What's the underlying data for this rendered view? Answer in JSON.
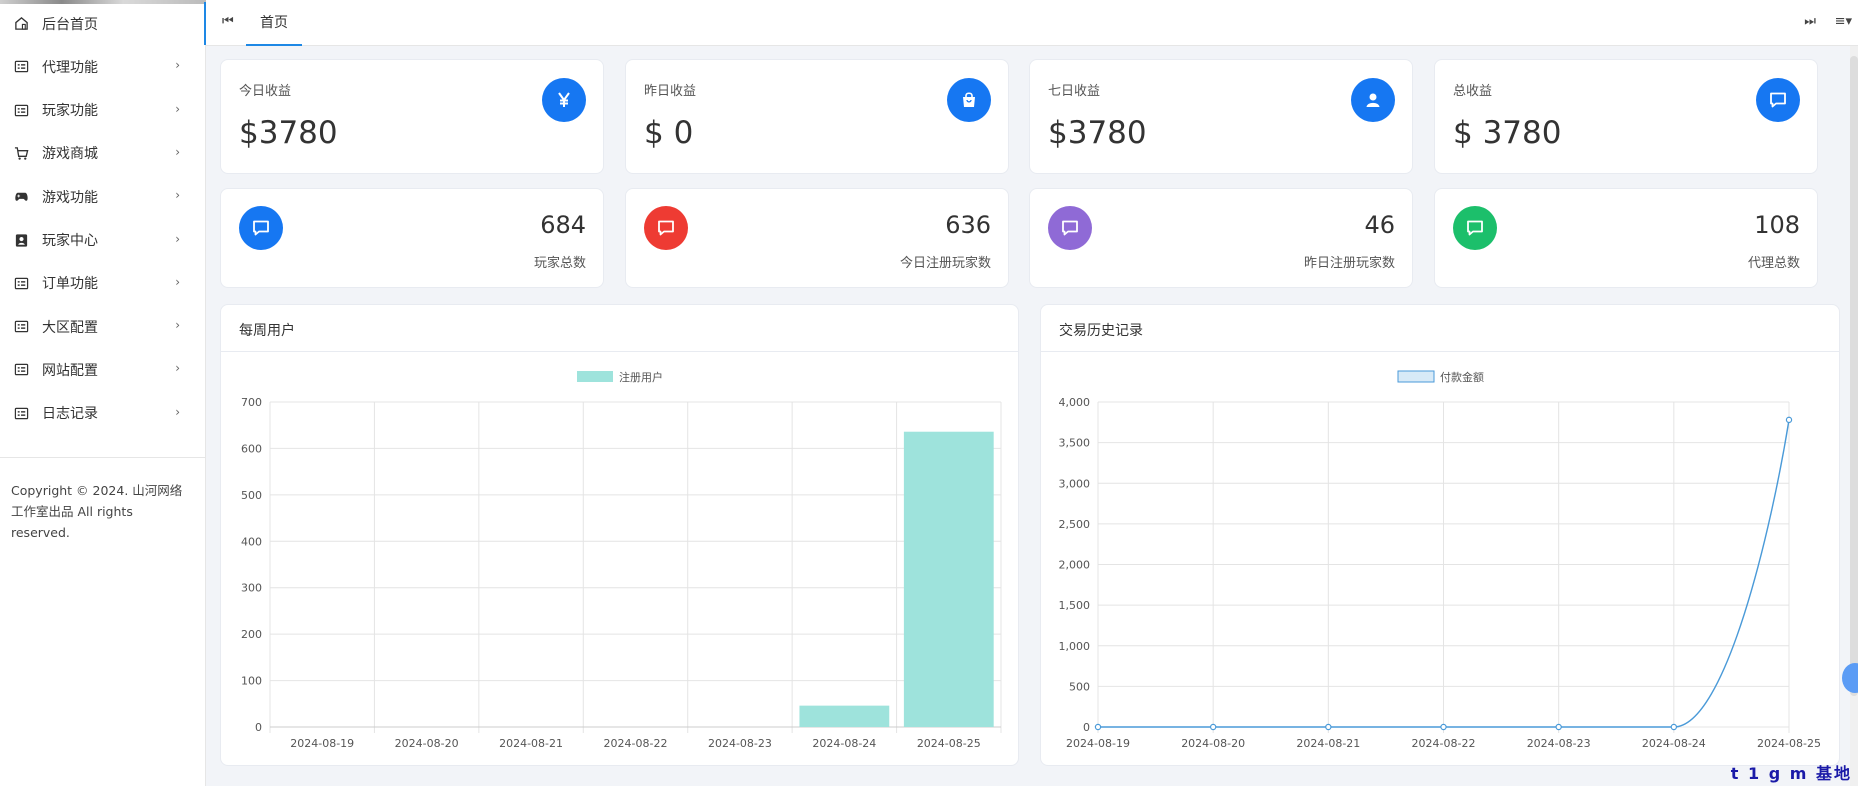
{
  "sidebar": {
    "items": [
      {
        "label": "后台首页",
        "icon": "home-icon",
        "has_arrow": false
      },
      {
        "label": "代理功能",
        "icon": "list-icon",
        "has_arrow": true
      },
      {
        "label": "玩家功能",
        "icon": "list-icon",
        "has_arrow": true
      },
      {
        "label": "游戏商城",
        "icon": "cart-icon",
        "has_arrow": true
      },
      {
        "label": "游戏功能",
        "icon": "gamepad-icon",
        "has_arrow": true
      },
      {
        "label": "玩家中心",
        "icon": "user-card-icon",
        "has_arrow": true
      },
      {
        "label": "订单功能",
        "icon": "list-icon",
        "has_arrow": true
      },
      {
        "label": "大区配置",
        "icon": "list-icon",
        "has_arrow": true
      },
      {
        "label": "网站配置",
        "icon": "list-icon",
        "has_arrow": true
      },
      {
        "label": "日志记录",
        "icon": "list-icon",
        "has_arrow": true
      }
    ],
    "arrow_glyph": "›",
    "copyright": "Copyright © 2024. 山河网络工作室出品 All rights reserved."
  },
  "topbar": {
    "prev_glyph": "⏮",
    "next_glyph": "⏭",
    "menu_glyph": "≡▾",
    "tab_label": "首页"
  },
  "stats": [
    {
      "title": "今日收益",
      "value": "$3780",
      "icon": "yen-icon",
      "color": "#1677f2"
    },
    {
      "title": "昨日收益",
      "value": "$ 0",
      "icon": "shopping-bag-icon",
      "color": "#1677f2"
    },
    {
      "title": "七日收益",
      "value": "$3780",
      "icon": "user-icon",
      "color": "#1677f2"
    },
    {
      "title": "总收益",
      "value": "$ 3780",
      "icon": "chat-icon",
      "color": "#1677f2"
    }
  ],
  "counts": [
    {
      "value": "684",
      "label": "玩家总数",
      "icon": "chat-icon",
      "color": "#1677f2"
    },
    {
      "value": "636",
      "label": "今日注册玩家数",
      "icon": "chat-icon",
      "color": "#ee3b33"
    },
    {
      "value": "46",
      "label": "昨日注册玩家数",
      "icon": "chat-icon",
      "color": "#8f6ad6"
    },
    {
      "value": "108",
      "label": "代理总数",
      "icon": "chat-icon",
      "color": "#1cbf6b"
    }
  ],
  "panels": {
    "weekly_title": "每周用户",
    "trade_title": "交易历史记录"
  },
  "chart_data": [
    {
      "type": "bar",
      "title": "",
      "categories": [
        "2024-08-19",
        "2024-08-20",
        "2024-08-21",
        "2024-08-22",
        "2024-08-23",
        "2024-08-24",
        "2024-08-25"
      ],
      "series": [
        {
          "name": "注册用户",
          "values": [
            0,
            0,
            0,
            0,
            0,
            46,
            636
          ]
        }
      ],
      "ylim": [
        0,
        700
      ],
      "yticks": [
        0,
        100,
        200,
        300,
        400,
        500,
        600,
        700
      ],
      "ytick_labels": [
        "0",
        "100",
        "200",
        "300",
        "400",
        "500",
        "600",
        "700"
      ],
      "grid": true,
      "legend": "top-center",
      "colors": {
        "fill": "#9ee3dc",
        "grid": "#e4e4e4"
      }
    },
    {
      "type": "line",
      "title": "",
      "categories": [
        "2024-08-19",
        "2024-08-20",
        "2024-08-21",
        "2024-08-22",
        "2024-08-23",
        "2024-08-24",
        "2024-08-25"
      ],
      "series": [
        {
          "name": "付款金额",
          "values": [
            0,
            0,
            0,
            0,
            0,
            0,
            3780
          ]
        }
      ],
      "ylim": [
        0,
        4000
      ],
      "yticks": [
        0,
        500,
        1000,
        1500,
        2000,
        2500,
        3000,
        3500,
        4000
      ],
      "ytick_labels": [
        "0",
        "500",
        "1,000",
        "1,500",
        "2,000",
        "2,500",
        "3,000",
        "3,500",
        "4,000"
      ],
      "grid": true,
      "legend": "top-center",
      "colors": {
        "line": "#4a9ad8",
        "legend_fill": "#d8eaf7",
        "grid": "#e4e4e4"
      }
    }
  ],
  "watermark": "t 1 g m 基地"
}
